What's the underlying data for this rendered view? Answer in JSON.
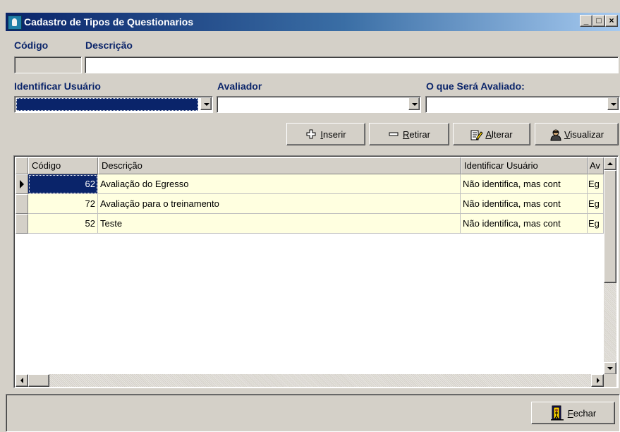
{
  "window": {
    "title": "Cadastro de Tipos de Questionarios",
    "controls": {
      "minimize": "_",
      "maximize": "□",
      "close": "×"
    }
  },
  "form": {
    "codigo_label": "Código",
    "descricao_label": "Descrição",
    "codigo_value": "",
    "descricao_value": "",
    "identificar_label": "Identificar Usuário",
    "avaliador_label": "Avaliador",
    "avaliado_label": "O que Será Avaliado:",
    "identificar_value": "",
    "avaliador_value": "",
    "avaliado_value": ""
  },
  "toolbar": {
    "inserir": {
      "accel": "I",
      "rest": "nserir",
      "icon": "plus-icon"
    },
    "retirar": {
      "accel": "R",
      "rest": "etirar",
      "icon": "minus-icon"
    },
    "alterar": {
      "accel": "A",
      "rest": "lterar",
      "icon": "edit-document-icon"
    },
    "visualizar": {
      "accel": "V",
      "rest": "isualizar",
      "icon": "view-person-icon"
    }
  },
  "grid": {
    "columns": [
      "Código",
      "Descrição",
      "Identificar Usuário",
      "Av"
    ],
    "rows": [
      {
        "codigo": "62",
        "descricao": "Avaliação do Egresso",
        "identificar": "Não identifica, mas cont",
        "avaliador": "Eg"
      },
      {
        "codigo": "72",
        "descricao": "Avaliação para o treinamento",
        "identificar": "Não identifica, mas cont",
        "avaliador": "Eg"
      },
      {
        "codigo": "52",
        "descricao": "Teste",
        "identificar": "Não identifica, mas cont",
        "avaliador": "Eg"
      }
    ],
    "selected_row": 0
  },
  "footer": {
    "fechar": {
      "accel": "F",
      "rest": "echar",
      "icon": "exit-door-icon"
    }
  },
  "colors": {
    "titlebar_start": "#0a246a",
    "titlebar_end": "#a6caf0",
    "label": "#0a246a",
    "row_background": "#ffffe0",
    "selection": "#0a246a",
    "face": "#d4d0c8"
  }
}
